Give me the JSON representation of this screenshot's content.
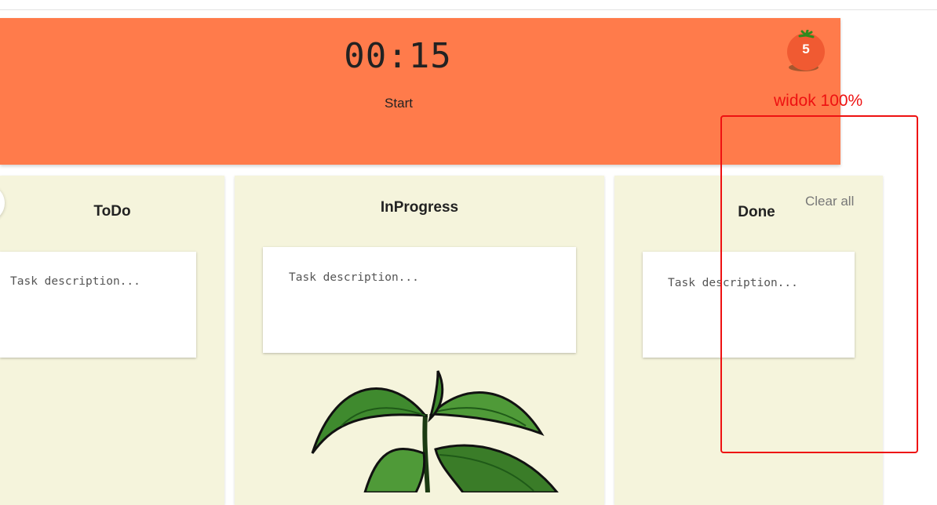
{
  "timer": {
    "time": "00:15",
    "start_label": "Start",
    "bar_color": "#ff7b4b"
  },
  "pomodoro_counter": {
    "count": "5",
    "icon": "tomato-icon"
  },
  "columns": {
    "todo": {
      "title": "ToDo",
      "task_placeholder": "Task description..."
    },
    "in_progress": {
      "title": "InProgress",
      "task_placeholder": "Task description..."
    },
    "done": {
      "title": "Done",
      "task_placeholder": "Task description...",
      "clear_label": "Clear all"
    }
  },
  "annotation": {
    "text": "widok 100%",
    "color": "#ee1111"
  },
  "colors": {
    "column_bg": "#f5f4dc",
    "card_bg": "#ffffff"
  },
  "decoration": {
    "icon": "plant-illustration"
  }
}
